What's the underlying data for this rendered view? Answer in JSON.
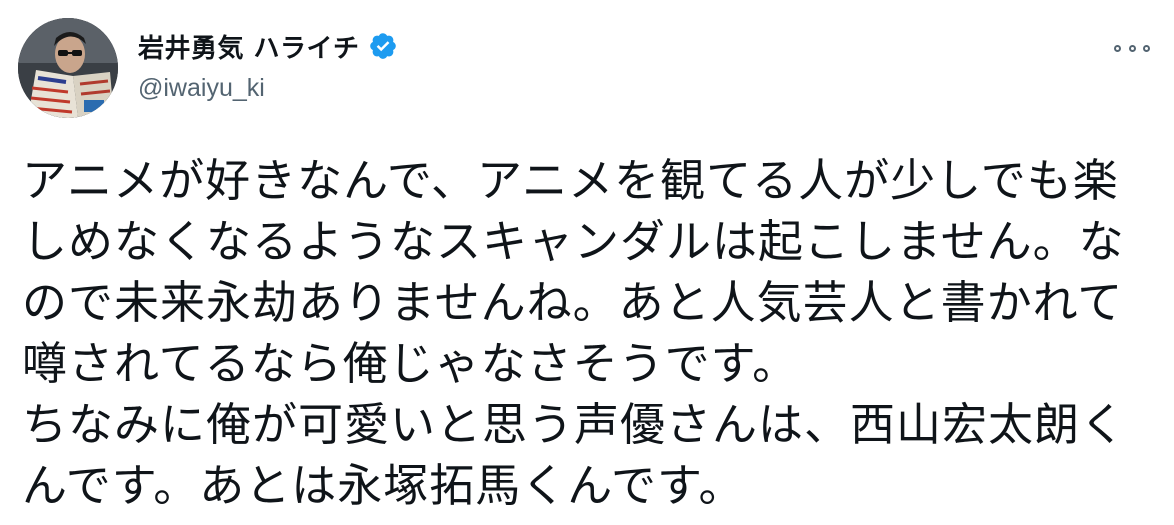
{
  "author": {
    "display_name": "岩井勇気 ハライチ",
    "handle": "@iwaiyu_ki",
    "verified": true,
    "verified_color": "#1d9bf0"
  },
  "menu": {
    "icon": "more-horizontal-icon"
  },
  "tweet": {
    "lines": [
      "アニメが好きなんで、アニメを観てる人が少しでも楽",
      "しめなくなるようなスキャンダルは起こしません。な",
      "ので未来永劫ありませんね。あと人気芸人と書かれて",
      "噂されてるなら俺じゃなさそうです。",
      "ちなみに俺が可愛いと思う声優さんは、西山宏太朗く",
      "んです。あとは永塚拓馬くんです。"
    ]
  }
}
